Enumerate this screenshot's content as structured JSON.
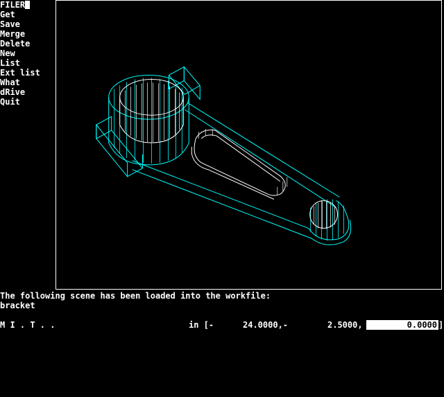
{
  "menu": {
    "title": "FILER",
    "items": [
      {
        "label": "Get"
      },
      {
        "label": "Save"
      },
      {
        "label": "Merge"
      },
      {
        "label": "Delete"
      },
      {
        "label": "New"
      },
      {
        "label": "List"
      },
      {
        "label": "Ext list"
      },
      {
        "label": "What"
      },
      {
        "label": "dRive"
      },
      {
        "label": "Quit"
      }
    ]
  },
  "message": {
    "line1": "The following scene has been loaded into the workfile:",
    "line2": "bracket"
  },
  "status": {
    "app": "M I . T . .",
    "units": "in [-",
    "x": "24.0000,-",
    "y": "2.5000,",
    "input_value": "0.0000",
    "close_bracket": "]"
  },
  "colors": {
    "background": "#000000",
    "wire_cyan": "#00ffff",
    "wire_white": "#ffffff",
    "text": "#ffffff"
  }
}
